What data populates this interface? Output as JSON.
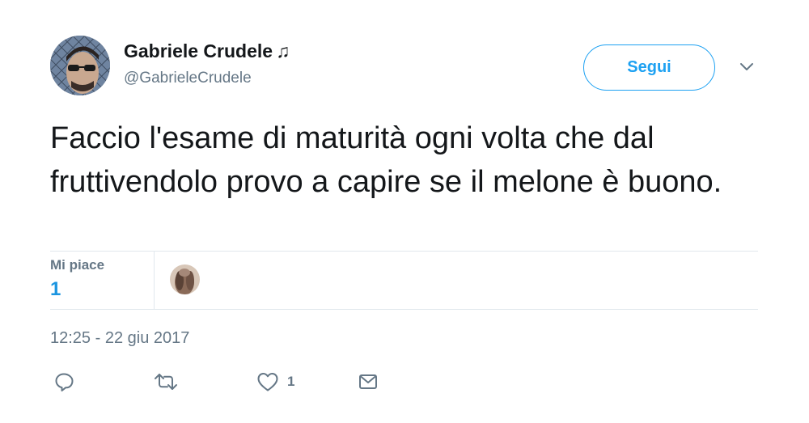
{
  "author": {
    "name": "Gabriele Crudele",
    "name_symbol": "♫",
    "handle": "@GabrieleCrudele"
  },
  "follow_button": {
    "label": "Segui"
  },
  "tweet": {
    "text": "Faccio l'esame di maturità ogni volta che dal fruttivendolo provo a capire se il melone è buono.",
    "timestamp": "12:25 - 22 giu 2017"
  },
  "stats": {
    "likes_label": "Mi piace",
    "likes_count": "1"
  },
  "actions": {
    "like_count": "1"
  },
  "icons": {
    "reply": "reply-icon",
    "retweet": "retweet-icon",
    "like": "heart-icon",
    "dm": "envelope-icon",
    "caret": "chevron-down-icon"
  },
  "colors": {
    "accent": "#1da1f2",
    "secondary_text": "#657786",
    "primary_text": "#14171a",
    "divider": "#e1e8ed"
  }
}
